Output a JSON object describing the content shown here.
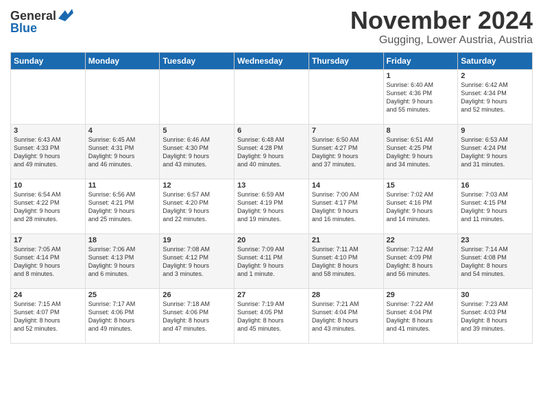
{
  "logo": {
    "general": "General",
    "blue": "Blue"
  },
  "header": {
    "month": "November 2024",
    "location": "Gugging, Lower Austria, Austria"
  },
  "weekdays": [
    "Sunday",
    "Monday",
    "Tuesday",
    "Wednesday",
    "Thursday",
    "Friday",
    "Saturday"
  ],
  "weeks": [
    [
      {
        "day": "",
        "info": ""
      },
      {
        "day": "",
        "info": ""
      },
      {
        "day": "",
        "info": ""
      },
      {
        "day": "",
        "info": ""
      },
      {
        "day": "",
        "info": ""
      },
      {
        "day": "1",
        "info": "Sunrise: 6:40 AM\nSunset: 4:36 PM\nDaylight: 9 hours\nand 55 minutes."
      },
      {
        "day": "2",
        "info": "Sunrise: 6:42 AM\nSunset: 4:34 PM\nDaylight: 9 hours\nand 52 minutes."
      }
    ],
    [
      {
        "day": "3",
        "info": "Sunrise: 6:43 AM\nSunset: 4:33 PM\nDaylight: 9 hours\nand 49 minutes."
      },
      {
        "day": "4",
        "info": "Sunrise: 6:45 AM\nSunset: 4:31 PM\nDaylight: 9 hours\nand 46 minutes."
      },
      {
        "day": "5",
        "info": "Sunrise: 6:46 AM\nSunset: 4:30 PM\nDaylight: 9 hours\nand 43 minutes."
      },
      {
        "day": "6",
        "info": "Sunrise: 6:48 AM\nSunset: 4:28 PM\nDaylight: 9 hours\nand 40 minutes."
      },
      {
        "day": "7",
        "info": "Sunrise: 6:50 AM\nSunset: 4:27 PM\nDaylight: 9 hours\nand 37 minutes."
      },
      {
        "day": "8",
        "info": "Sunrise: 6:51 AM\nSunset: 4:25 PM\nDaylight: 9 hours\nand 34 minutes."
      },
      {
        "day": "9",
        "info": "Sunrise: 6:53 AM\nSunset: 4:24 PM\nDaylight: 9 hours\nand 31 minutes."
      }
    ],
    [
      {
        "day": "10",
        "info": "Sunrise: 6:54 AM\nSunset: 4:22 PM\nDaylight: 9 hours\nand 28 minutes."
      },
      {
        "day": "11",
        "info": "Sunrise: 6:56 AM\nSunset: 4:21 PM\nDaylight: 9 hours\nand 25 minutes."
      },
      {
        "day": "12",
        "info": "Sunrise: 6:57 AM\nSunset: 4:20 PM\nDaylight: 9 hours\nand 22 minutes."
      },
      {
        "day": "13",
        "info": "Sunrise: 6:59 AM\nSunset: 4:19 PM\nDaylight: 9 hours\nand 19 minutes."
      },
      {
        "day": "14",
        "info": "Sunrise: 7:00 AM\nSunset: 4:17 PM\nDaylight: 9 hours\nand 16 minutes."
      },
      {
        "day": "15",
        "info": "Sunrise: 7:02 AM\nSunset: 4:16 PM\nDaylight: 9 hours\nand 14 minutes."
      },
      {
        "day": "16",
        "info": "Sunrise: 7:03 AM\nSunset: 4:15 PM\nDaylight: 9 hours\nand 11 minutes."
      }
    ],
    [
      {
        "day": "17",
        "info": "Sunrise: 7:05 AM\nSunset: 4:14 PM\nDaylight: 9 hours\nand 8 minutes."
      },
      {
        "day": "18",
        "info": "Sunrise: 7:06 AM\nSunset: 4:13 PM\nDaylight: 9 hours\nand 6 minutes."
      },
      {
        "day": "19",
        "info": "Sunrise: 7:08 AM\nSunset: 4:12 PM\nDaylight: 9 hours\nand 3 minutes."
      },
      {
        "day": "20",
        "info": "Sunrise: 7:09 AM\nSunset: 4:11 PM\nDaylight: 9 hours\nand 1 minute."
      },
      {
        "day": "21",
        "info": "Sunrise: 7:11 AM\nSunset: 4:10 PM\nDaylight: 8 hours\nand 58 minutes."
      },
      {
        "day": "22",
        "info": "Sunrise: 7:12 AM\nSunset: 4:09 PM\nDaylight: 8 hours\nand 56 minutes."
      },
      {
        "day": "23",
        "info": "Sunrise: 7:14 AM\nSunset: 4:08 PM\nDaylight: 8 hours\nand 54 minutes."
      }
    ],
    [
      {
        "day": "24",
        "info": "Sunrise: 7:15 AM\nSunset: 4:07 PM\nDaylight: 8 hours\nand 52 minutes."
      },
      {
        "day": "25",
        "info": "Sunrise: 7:17 AM\nSunset: 4:06 PM\nDaylight: 8 hours\nand 49 minutes."
      },
      {
        "day": "26",
        "info": "Sunrise: 7:18 AM\nSunset: 4:06 PM\nDaylight: 8 hours\nand 47 minutes."
      },
      {
        "day": "27",
        "info": "Sunrise: 7:19 AM\nSunset: 4:05 PM\nDaylight: 8 hours\nand 45 minutes."
      },
      {
        "day": "28",
        "info": "Sunrise: 7:21 AM\nSunset: 4:04 PM\nDaylight: 8 hours\nand 43 minutes."
      },
      {
        "day": "29",
        "info": "Sunrise: 7:22 AM\nSunset: 4:04 PM\nDaylight: 8 hours\nand 41 minutes."
      },
      {
        "day": "30",
        "info": "Sunrise: 7:23 AM\nSunset: 4:03 PM\nDaylight: 8 hours\nand 39 minutes."
      }
    ]
  ]
}
